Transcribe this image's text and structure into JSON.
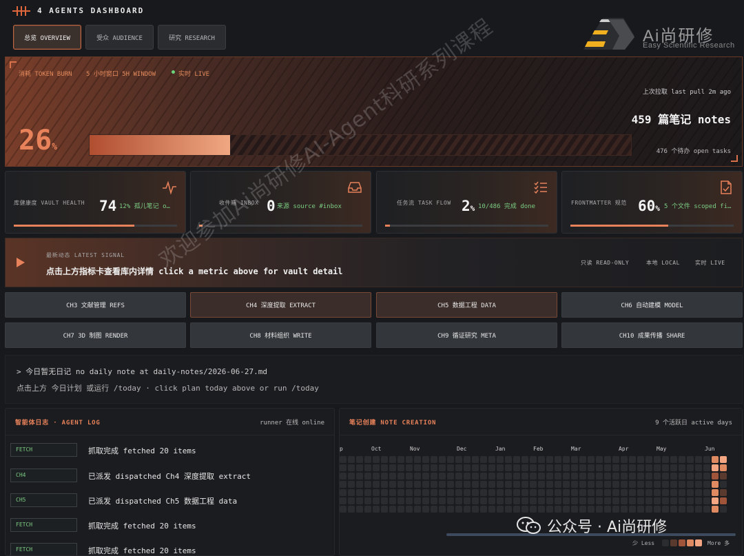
{
  "header": {
    "title": "4 AGENTS DASHBOARD",
    "tabs": [
      {
        "label": "总览 OVERVIEW",
        "active": true
      },
      {
        "label": "受众 AUDIENCE",
        "active": false
      },
      {
        "label": "研究 RESEARCH",
        "active": false
      }
    ]
  },
  "brand": {
    "name": "Ai尚研修",
    "tagline": "Easy Scientific Research"
  },
  "hero": {
    "label_burn": "消耗 TOKEN BURN",
    "label_window": "5 小时窗口 5H WINDOW",
    "label_live": "实时 LIVE",
    "percent": "26",
    "percent_unit": "%",
    "progress": 0.26,
    "last_pull": "上次拉取 last pull 2m ago",
    "notes_count": "459 篇笔记 notes",
    "open_tasks": "476 个待办 open tasks"
  },
  "metrics": [
    {
      "label": "库健康度 VAULT HEALTH",
      "value": "74",
      "unit": "",
      "sub": "12% 孤儿笔记 o…",
      "progress": 0.74,
      "icon": "pulse-icon"
    },
    {
      "label": "收件箱 INBOX",
      "value": "0",
      "unit": "",
      "sub": "来源 source #inbox",
      "progress": 0.02,
      "icon": "inbox-icon"
    },
    {
      "label": "任务流 TASK FLOW",
      "value": "2",
      "unit": "%",
      "sub": "10/486 完成 done",
      "progress": 0.03,
      "icon": "checklist-icon"
    },
    {
      "label": "FRONTMATTER 规范",
      "value": "60",
      "unit": "%",
      "sub": "5 个文件 scoped fi…",
      "progress": 0.6,
      "icon": "file-check-icon"
    }
  ],
  "signal": {
    "kicker": "最新动态 LATEST SIGNAL",
    "message": "点击上方指标卡查看库内详情 click a metric above for vault detail",
    "flags": [
      "只读 READ-ONLY",
      "本地 LOCAL",
      "实时 LIVE"
    ]
  },
  "chapters": [
    {
      "label": "CH3 文献管理 REFS",
      "hot": false
    },
    {
      "label": "CH4 深度提取 EXTRACT",
      "hot": true
    },
    {
      "label": "CH5 数据工程 DATA",
      "hot": true
    },
    {
      "label": "CH6 自动建模 MODEL",
      "hot": false
    },
    {
      "label": "CH7 3D 制图 RENDER",
      "hot": false
    },
    {
      "label": "CH8 材料组织 WRITE",
      "hot": false
    },
    {
      "label": "CH9 循证研究 META",
      "hot": false
    },
    {
      "label": "CH10 成果传播 SHARE",
      "hot": false
    }
  ],
  "daily": {
    "line1": "> 今日暂无日记 no daily note at daily-notes/2026-06-27.md",
    "line2": "点击上方 今日计划 或运行 /today · click plan today above or run /today"
  },
  "agent_log": {
    "title": "智能体日志 · AGENT LOG",
    "status": "runner 在线 online",
    "rows": [
      {
        "tag": "FETCH",
        "message": "抓取完成 fetched 20 items"
      },
      {
        "tag": "CH4",
        "message": "已派发 dispatched Ch4 深度提取 extract"
      },
      {
        "tag": "CH5",
        "message": "已派发 dispatched Ch5 数据工程 data"
      },
      {
        "tag": "FETCH",
        "message": "抓取完成 fetched 20 items"
      },
      {
        "tag": "FETCH",
        "message": "抓取完成 fetched 20 items"
      }
    ]
  },
  "note_creation": {
    "title": "笔记创建 NOTE CREATION",
    "status": "9 个活跃日 active days",
    "months": [
      "p",
      "Oct",
      "Nov",
      "Dec",
      "Jan",
      "Feb",
      "Mar",
      "Apr",
      "May",
      "Jun"
    ],
    "legend_less": "少 Less",
    "legend_more": "More 多",
    "colors": {
      "empty": "#2a2c30",
      "l1": "#5a3a2e",
      "l2": "#a0553a",
      "l3": "#e08a62",
      "l4": "#f4a582"
    }
  },
  "watermark": {
    "diagonal": "欢迎参加Ai尚研修AI-Agent科研系列课程",
    "wechat": "公众号 · Ai尚研修"
  },
  "colors": {
    "accent": "#e8825a",
    "positive": "#7ccd83",
    "background": "#17191c"
  }
}
